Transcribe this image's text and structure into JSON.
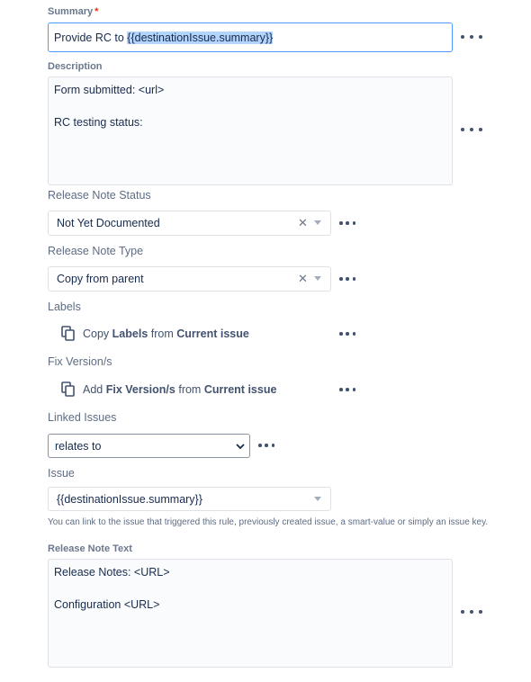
{
  "summary": {
    "label": "Summary",
    "required_mark": "*",
    "value_plain": "Provide RC to ",
    "value_selected": "{{destinationIssue.summary}}"
  },
  "description": {
    "label": "Description",
    "lines": [
      "Form submitted: <url>",
      "",
      "RC testing status:"
    ]
  },
  "release_note_status": {
    "label": "Release Note Status",
    "value": "Not Yet Documented"
  },
  "release_note_type": {
    "label": "Release Note Type",
    "value": "Copy from parent"
  },
  "labels": {
    "label": "Labels",
    "verb": "Copy",
    "field": "Labels",
    "from": "from",
    "source": "Current issue"
  },
  "fix_versions": {
    "label": "Fix Version/s",
    "verb": "Add",
    "field": "Fix Version/s",
    "from": "from",
    "source": "Current issue"
  },
  "linked_issues": {
    "label": "Linked Issues",
    "value": "relates to",
    "options": [
      "relates to"
    ]
  },
  "issue": {
    "label": "Issue",
    "value": "{{destinationIssue.summary}}",
    "help": "You can link to the issue that triggered this rule, previously created issue, a smart-value or simply an issue key."
  },
  "release_note_text": {
    "label": "Release Note Text",
    "lines": [
      "Release Notes: <URL>",
      "",
      "Configuration <URL>"
    ]
  },
  "icons": {
    "more": "more-horizontal-icon",
    "copy": "copy-icon",
    "clear": "clear-icon",
    "caret": "chevron-down-icon"
  }
}
